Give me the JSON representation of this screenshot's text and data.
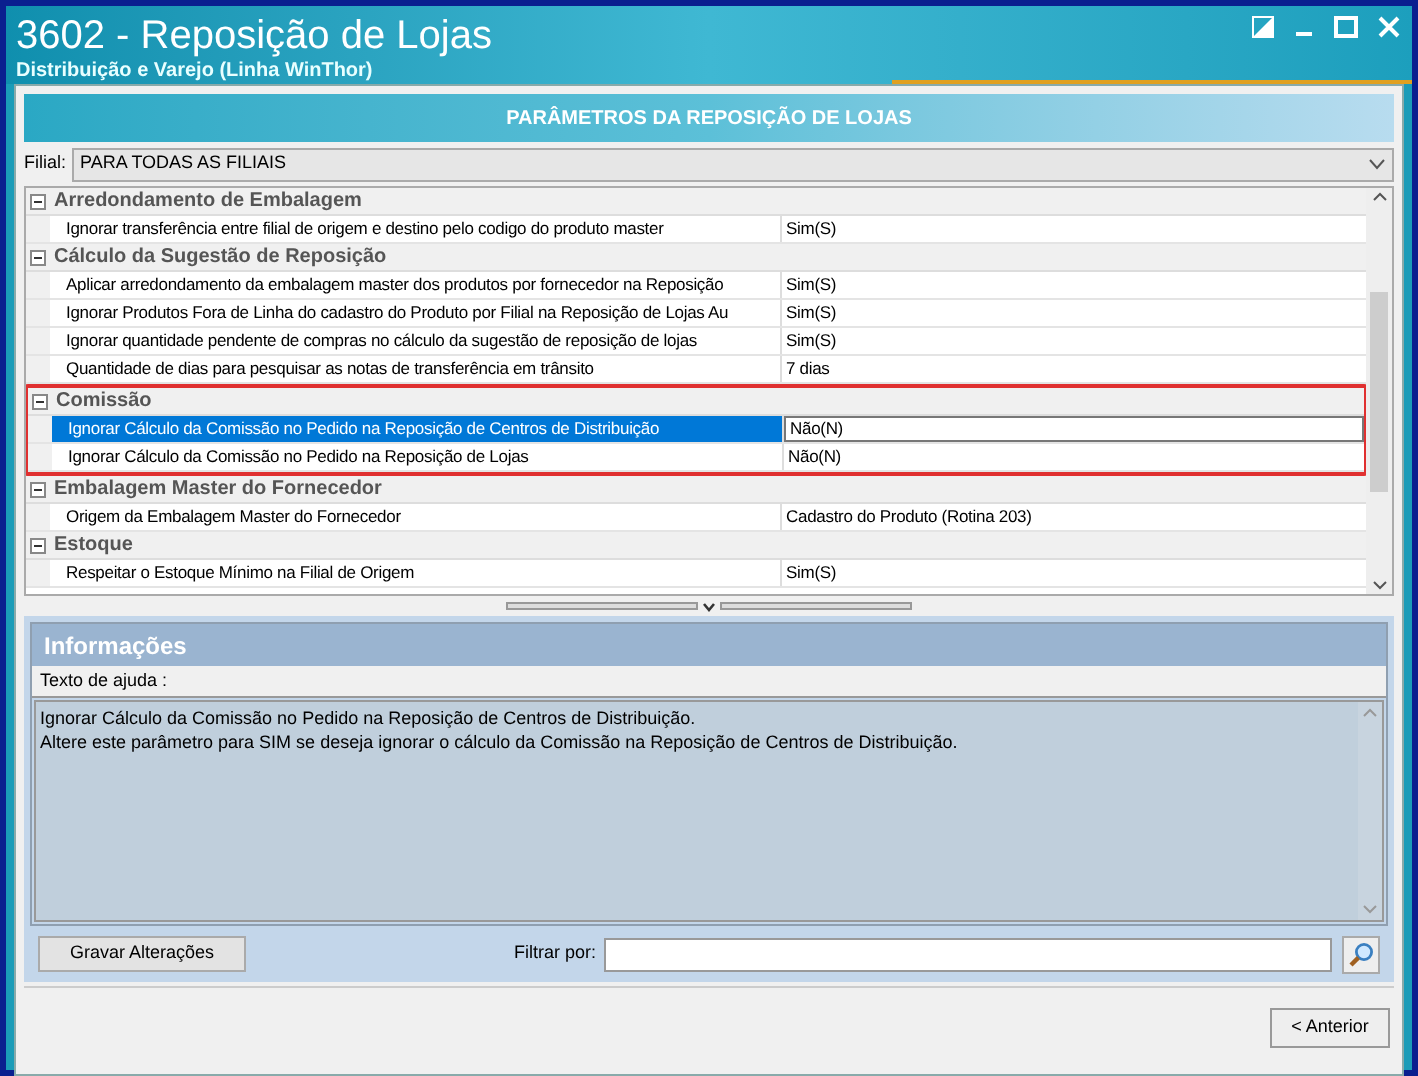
{
  "window": {
    "title": "3602 - Reposição de Lojas",
    "subtitle": "Distribuição e Varejo (Linha WinThor)"
  },
  "header": "PARÂMETROS DA REPOSIÇÃO DE LOJAS",
  "filial": {
    "label": "Filial:",
    "value": "PARA TODAS AS FILIAIS"
  },
  "groups": [
    {
      "title": "Arredondamento de Embalagem",
      "expanded": true,
      "highlighted": false,
      "rows": [
        {
          "name": "Ignorar transferência entre filial de origem e destino pelo codigo do produto master",
          "value": "Sim(S)",
          "selected": false
        }
      ]
    },
    {
      "title": "Cálculo da Sugestão de Reposição",
      "expanded": true,
      "highlighted": false,
      "rows": [
        {
          "name": "Aplicar arredondamento da embalagem master dos produtos por fornecedor na Reposição",
          "value": "Sim(S)",
          "selected": false
        },
        {
          "name": "Ignorar Produtos Fora de Linha do cadastro do Produto por Filial na Reposição de Lojas Au",
          "value": "Sim(S)",
          "selected": false
        },
        {
          "name": "Ignorar quantidade pendente de compras no cálculo da sugestão de reposição de lojas",
          "value": "Sim(S)",
          "selected": false
        },
        {
          "name": "Quantidade de dias para pesquisar as notas de transferência em trânsito",
          "value": "7 dias",
          "selected": false
        }
      ]
    },
    {
      "title": "Comissão",
      "expanded": true,
      "highlighted": true,
      "rows": [
        {
          "name": "Ignorar Cálculo da Comissão no Pedido na Reposição de Centros de Distribuição",
          "value": "Não(N)",
          "selected": true
        },
        {
          "name": "Ignorar Cálculo da Comissão no Pedido na Reposição de Lojas",
          "value": "Não(N)",
          "selected": false
        }
      ]
    },
    {
      "title": "Embalagem Master do Fornecedor",
      "expanded": true,
      "highlighted": false,
      "rows": [
        {
          "name": "Origem da Embalagem Master do Fornecedor",
          "value": "Cadastro do Produto (Rotina 203)",
          "selected": false
        }
      ]
    },
    {
      "title": "Estoque",
      "expanded": true,
      "highlighted": false,
      "rows": [
        {
          "name": "Respeitar o Estoque Mínimo na Filial de Origem",
          "value": "Sim(S)",
          "selected": false
        }
      ]
    }
  ],
  "info": {
    "title": "Informações",
    "label": "Texto de ajuda :",
    "lines": [
      "Ignorar Cálculo da Comissão no Pedido na Reposição de Centros de Distribuição.",
      "Altere este parâmetro para SIM se deseja ignorar o cálculo da Comissão na Reposição de Centros de Distribuição."
    ]
  },
  "save_button": "Gravar Alterações",
  "filter": {
    "label": "Filtrar por:"
  },
  "back_button": "< Anterior"
}
